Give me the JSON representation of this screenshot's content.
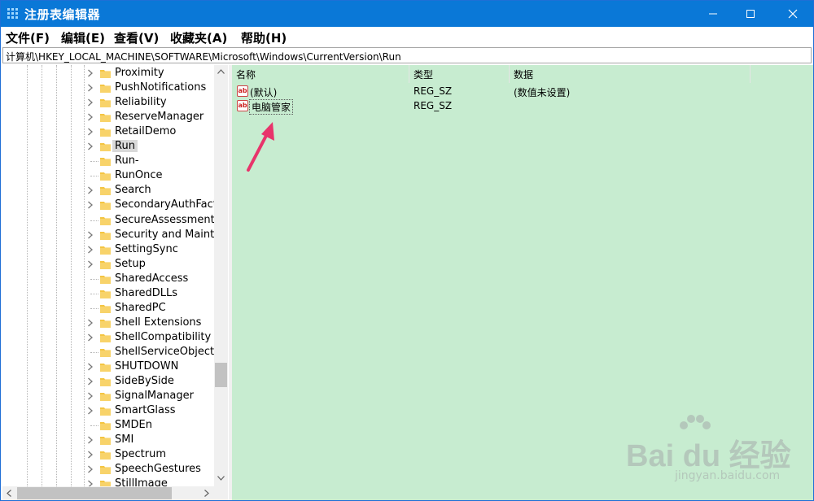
{
  "window": {
    "title": "注册表编辑器"
  },
  "menu": [
    "文件(F)",
    "编辑(E)",
    "查看(V)",
    "收藏夹(A)",
    "帮助(H)"
  ],
  "address": "计算机\\HKEY_LOCAL_MACHINE\\SOFTWARE\\Microsoft\\Windows\\CurrentVersion\\Run",
  "tree": {
    "items": [
      {
        "label": "Proximity",
        "expandable": true
      },
      {
        "label": "PushNotifications",
        "expandable": true
      },
      {
        "label": "Reliability",
        "expandable": true
      },
      {
        "label": "ReserveManager",
        "expandable": true
      },
      {
        "label": "RetailDemo",
        "expandable": true
      },
      {
        "label": "Run",
        "expandable": true,
        "selected": true
      },
      {
        "label": "Run-",
        "expandable": false
      },
      {
        "label": "RunOnce",
        "expandable": false
      },
      {
        "label": "Search",
        "expandable": true
      },
      {
        "label": "SecondaryAuthFacto",
        "expandable": true
      },
      {
        "label": "SecureAssessment",
        "expandable": false
      },
      {
        "label": "Security and Mainter",
        "expandable": true
      },
      {
        "label": "SettingSync",
        "expandable": true
      },
      {
        "label": "Setup",
        "expandable": true
      },
      {
        "label": "SharedAccess",
        "expandable": false
      },
      {
        "label": "SharedDLLs",
        "expandable": false
      },
      {
        "label": "SharedPC",
        "expandable": false
      },
      {
        "label": "Shell Extensions",
        "expandable": true
      },
      {
        "label": "ShellCompatibility",
        "expandable": true
      },
      {
        "label": "ShellServiceObjectD",
        "expandable": false
      },
      {
        "label": "SHUTDOWN",
        "expandable": true
      },
      {
        "label": "SideBySide",
        "expandable": true
      },
      {
        "label": "SignalManager",
        "expandable": true
      },
      {
        "label": "SmartGlass",
        "expandable": true
      },
      {
        "label": "SMDEn",
        "expandable": false
      },
      {
        "label": "SMI",
        "expandable": true
      },
      {
        "label": "Spectrum",
        "expandable": true
      },
      {
        "label": "SpeechGestures",
        "expandable": true
      },
      {
        "label": "StillImage",
        "expandable": true
      }
    ]
  },
  "values": {
    "columns": [
      "名称",
      "类型",
      "数据"
    ],
    "rows": [
      {
        "name": "(默认)",
        "type": "REG_SZ",
        "data": "(数值未设置)",
        "icon": "ab-string-icon"
      },
      {
        "name": "电脑管家",
        "type": "REG_SZ",
        "data": "",
        "icon": "ab-string-icon",
        "editing": true
      }
    ]
  },
  "colors": {
    "titlebar": "#0a78d7",
    "pane_bg": "#c7ecd0",
    "arrow": "#e8346b"
  },
  "watermark": {
    "logo": "Bai du 经验",
    "url": "jingyan.baidu.com"
  }
}
